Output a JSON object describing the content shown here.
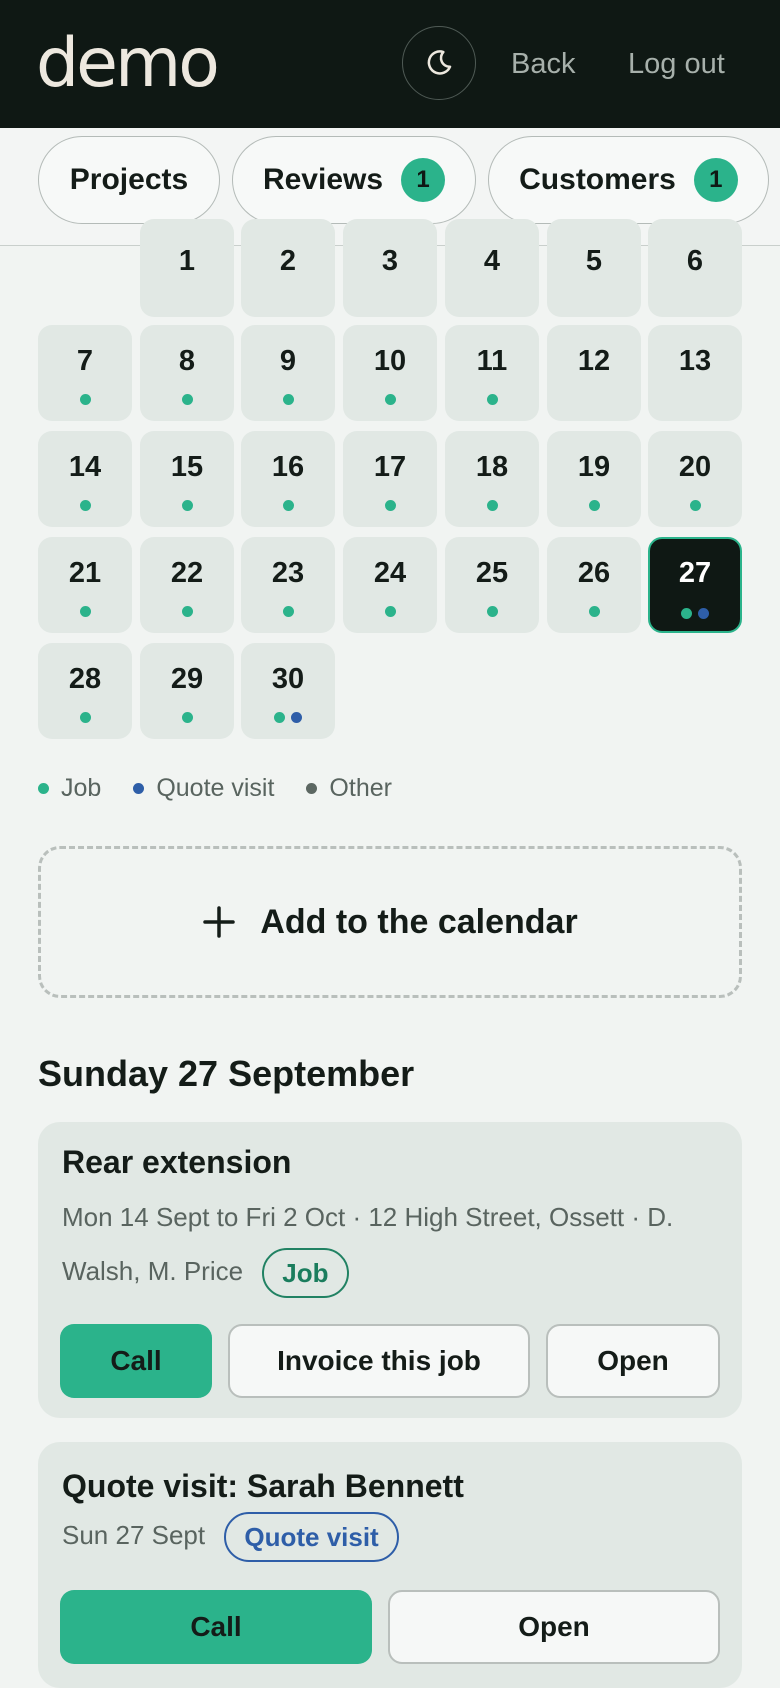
{
  "header": {
    "logo": "demo",
    "theme_icon": "moon-icon",
    "back_label": "Back",
    "logout_label": "Log out"
  },
  "tabs": [
    {
      "label": "Projects",
      "badge": null
    },
    {
      "label": "Reviews",
      "badge": "1"
    },
    {
      "label": "Customers",
      "badge": "1"
    }
  ],
  "calendar": {
    "selected_day": "27",
    "days": [
      {
        "day": "1",
        "markers": []
      },
      {
        "day": "2",
        "markers": []
      },
      {
        "day": "3",
        "markers": []
      },
      {
        "day": "4",
        "markers": []
      },
      {
        "day": "5",
        "markers": []
      },
      {
        "day": "6",
        "markers": []
      },
      {
        "day": "7",
        "markers": [
          "job"
        ]
      },
      {
        "day": "8",
        "markers": [
          "job"
        ]
      },
      {
        "day": "9",
        "markers": [
          "job"
        ]
      },
      {
        "day": "10",
        "markers": [
          "job"
        ]
      },
      {
        "day": "11",
        "markers": [
          "job"
        ]
      },
      {
        "day": "12",
        "markers": []
      },
      {
        "day": "13",
        "markers": []
      },
      {
        "day": "14",
        "markers": [
          "job"
        ]
      },
      {
        "day": "15",
        "markers": [
          "job"
        ]
      },
      {
        "day": "16",
        "markers": [
          "job"
        ]
      },
      {
        "day": "17",
        "markers": [
          "job"
        ]
      },
      {
        "day": "18",
        "markers": [
          "job"
        ]
      },
      {
        "day": "19",
        "markers": [
          "job"
        ]
      },
      {
        "day": "20",
        "markers": [
          "job"
        ]
      },
      {
        "day": "21",
        "markers": [
          "job"
        ]
      },
      {
        "day": "22",
        "markers": [
          "job"
        ]
      },
      {
        "day": "23",
        "markers": [
          "job"
        ]
      },
      {
        "day": "24",
        "markers": [
          "job"
        ]
      },
      {
        "day": "25",
        "markers": [
          "job"
        ]
      },
      {
        "day": "26",
        "markers": [
          "job"
        ]
      },
      {
        "day": "27",
        "markers": [
          "job",
          "quote"
        ]
      },
      {
        "day": "28",
        "markers": [
          "job"
        ]
      },
      {
        "day": "29",
        "markers": [
          "job"
        ]
      },
      {
        "day": "30",
        "markers": [
          "job",
          "quote"
        ]
      }
    ],
    "legend": [
      {
        "type": "job",
        "label": "Job",
        "color": "#2bb38b"
      },
      {
        "type": "quote",
        "label": "Quote visit",
        "color": "#2e5ea8"
      },
      {
        "type": "other",
        "label": "Other",
        "color": "#5c6762"
      }
    ]
  },
  "add_to_calendar": {
    "icon": "plus-icon",
    "label": "Add to the calendar"
  },
  "agenda": {
    "date_heading": "Sunday 27 September",
    "events": [
      {
        "title": "Rear extension",
        "meta_line1": "Mon 14 Sept to Fri 2 Oct · 12 High Street, Ossett · D.",
        "meta_line2": "Walsh, M. Price",
        "tag": "Job",
        "actions": [
          "Call",
          "Invoice this job",
          "Open"
        ]
      },
      {
        "title": "Quote visit: Sarah Bennett",
        "meta_line1": "Sun 27 Sept",
        "tag": "Quote visit",
        "actions": [
          "Call",
          "Open"
        ]
      }
    ]
  },
  "colors": {
    "accent": "#2bb38b",
    "quote": "#2e5ea8",
    "header_bg": "#0f1814"
  }
}
